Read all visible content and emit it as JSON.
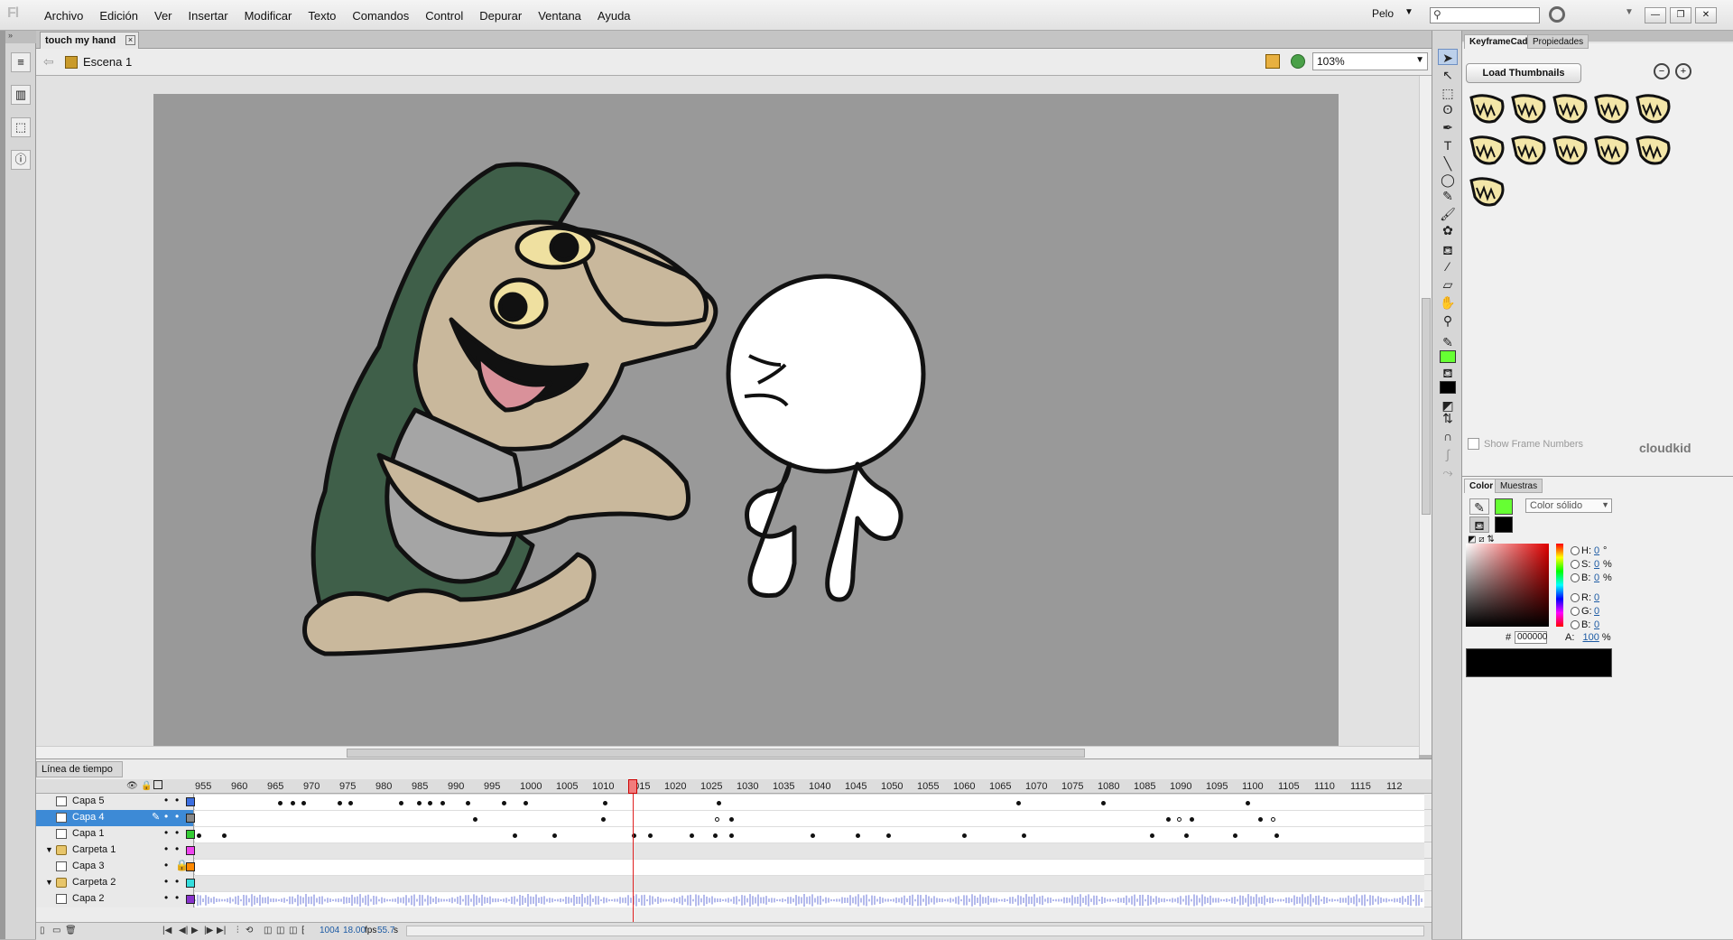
{
  "app": {
    "logo": "Fl"
  },
  "menus": [
    "Archivo",
    "Edición",
    "Ver",
    "Insertar",
    "Modificar",
    "Texto",
    "Comandos",
    "Control",
    "Depurar",
    "Ventana",
    "Ayuda"
  ],
  "workspace": {
    "label": "Pelo"
  },
  "document": {
    "tab_label": "touch my hand",
    "scene_label": "Escena 1",
    "zoom": "103%"
  },
  "timeline": {
    "panel_label": "Línea de tiempo",
    "frame_numbers": [
      "955",
      "960",
      "965",
      "970",
      "975",
      "980",
      "985",
      "990",
      "995",
      "1000",
      "1005",
      "1010",
      "1015",
      "1020",
      "1025",
      "1030",
      "1035",
      "1040",
      "1045",
      "1050",
      "1055",
      "1060",
      "1065",
      "1070",
      "1075",
      "1080",
      "1085",
      "1090",
      "1095",
      "1100",
      "1105",
      "1110",
      "1115",
      "112"
    ],
    "layers": [
      {
        "name": "Capa 5",
        "color": "#3b6ee0",
        "type": "layer",
        "selected": false,
        "locked": false
      },
      {
        "name": "Capa 4",
        "color": "#888888",
        "type": "layer",
        "selected": true,
        "locked": false
      },
      {
        "name": "Capa 1",
        "color": "#33cc33",
        "type": "layer",
        "selected": false,
        "locked": false
      },
      {
        "name": "Carpeta 1",
        "color": "#ee44ee",
        "type": "folder",
        "selected": false,
        "locked": false
      },
      {
        "name": "Capa 3",
        "color": "#ff8800",
        "type": "layer",
        "selected": false,
        "locked": true
      },
      {
        "name": "Carpeta 2",
        "color": "#33dddd",
        "type": "folder",
        "selected": false,
        "locked": false
      },
      {
        "name": "Capa 2",
        "color": "#8833cc",
        "type": "layer",
        "selected": false,
        "locked": false
      }
    ],
    "current_frame": "1004",
    "fps": "18.00",
    "fps_unit": "fps",
    "seconds": "55.7",
    "seconds_unit": "s"
  },
  "keyframe_caddy": {
    "tab_active": "KeyframeCaddy",
    "tab_other": "Propiedades",
    "load_button": "Load Thumbnails",
    "show_frame_numbers": "Show Frame Numbers",
    "brand": "cloudkid"
  },
  "color_panel": {
    "tab_active": "Color",
    "tab_other": "Muestras",
    "type": "Color sólido",
    "stroke_color": "#66ff33",
    "fill_color": "#000000",
    "h": "0",
    "h_unit": "°",
    "s": "0",
    "s_unit": "%",
    "b": "0",
    "b_unit": "%",
    "r": "0",
    "g": "0",
    "bl": "0",
    "hex": "000000",
    "alpha": "100",
    "alpha_unit": "%",
    "labels": {
      "h": "H:",
      "s": "S:",
      "b": "B:",
      "r": "R:",
      "g": "G:",
      "bl": "B:",
      "hash": "#",
      "a": "A:"
    }
  }
}
